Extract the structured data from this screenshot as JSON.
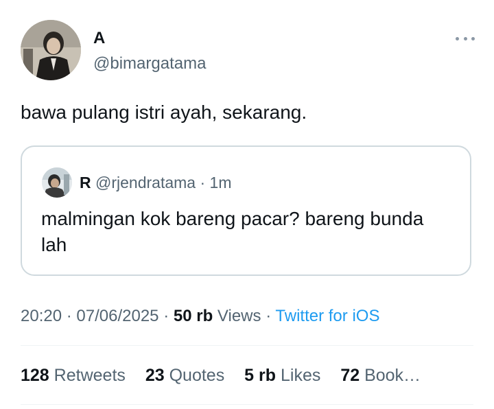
{
  "author": {
    "display_name": "A",
    "handle": "@bimargatama"
  },
  "tweet": {
    "text": "bawa pulang istri ayah, sekarang."
  },
  "quoted_tweet": {
    "display_name": "R",
    "handle": "@rjendratama",
    "separator": "·",
    "time": "1m",
    "text": "malmingan kok bareng pacar? bareng bunda lah"
  },
  "meta": {
    "time": "20:20",
    "sep1": "·",
    "date": "07/06/2025",
    "sep2": "·",
    "views_count": "50 rb",
    "views_label": "Views",
    "sep3": "·",
    "source": "Twitter for iOS"
  },
  "stats": [
    {
      "count": "128",
      "label": "Retweets"
    },
    {
      "count": "23",
      "label": "Quotes"
    },
    {
      "count": "5 rb",
      "label": "Likes"
    },
    {
      "count": "72",
      "label": "Book…"
    }
  ],
  "icons": {
    "more": "more-horizontal-icon"
  },
  "colors": {
    "text_primary": "#0f1419",
    "text_secondary": "#536471",
    "link": "#1d9bf0",
    "border": "#cfd9de",
    "divider": "#eff3f4"
  }
}
